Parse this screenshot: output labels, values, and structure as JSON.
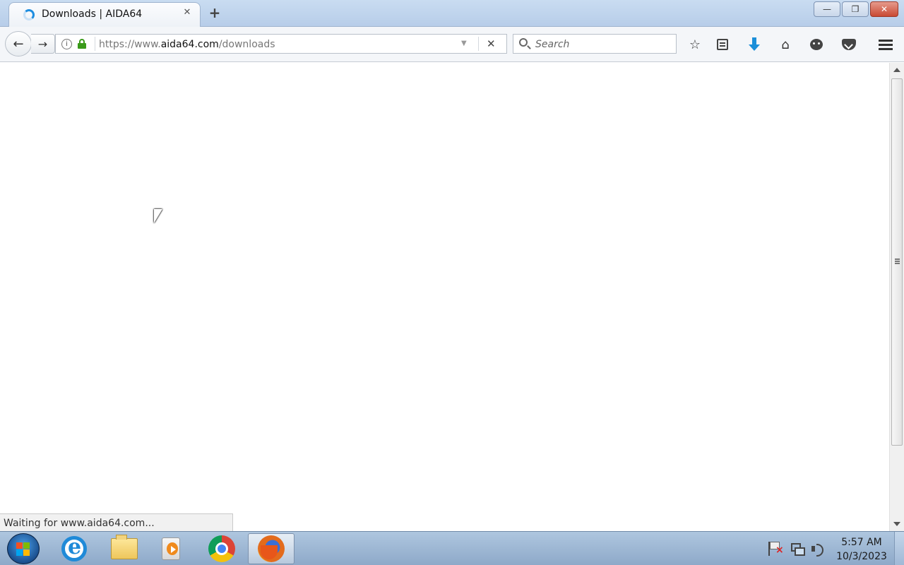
{
  "browser": {
    "tab": {
      "title": "Downloads | AIDA64",
      "close_label": "✕"
    },
    "new_tab_label": "+",
    "window_buttons": {
      "minimize": "—",
      "restore": "❐",
      "close": "✕"
    },
    "nav": {
      "back_label": "←",
      "forward_label": "→"
    },
    "address": {
      "info_label": "i",
      "url_scheme": "https://www.",
      "url_host": "aida64.com",
      "url_path": "/downloads",
      "dropdown_label": "▼",
      "stop_label": "✕"
    },
    "search": {
      "placeholder": "Search"
    },
    "toolbar": {
      "star_label": "☆",
      "home_label": "⌂"
    },
    "status_text": "Waiting for www.aida64.com..."
  },
  "taskbar": {
    "pinned_apps": [
      "start-button",
      "internet-explorer",
      "windows-explorer",
      "media-player",
      "chrome",
      "firefox"
    ],
    "active_app": "firefox",
    "clock": {
      "time": "5:57 AM",
      "date": "10/3/2023"
    }
  },
  "colors": {
    "accent_download": "#1b8fd9",
    "lock_green": "#3a9a1a",
    "taskbar": "#9fb8d6"
  }
}
